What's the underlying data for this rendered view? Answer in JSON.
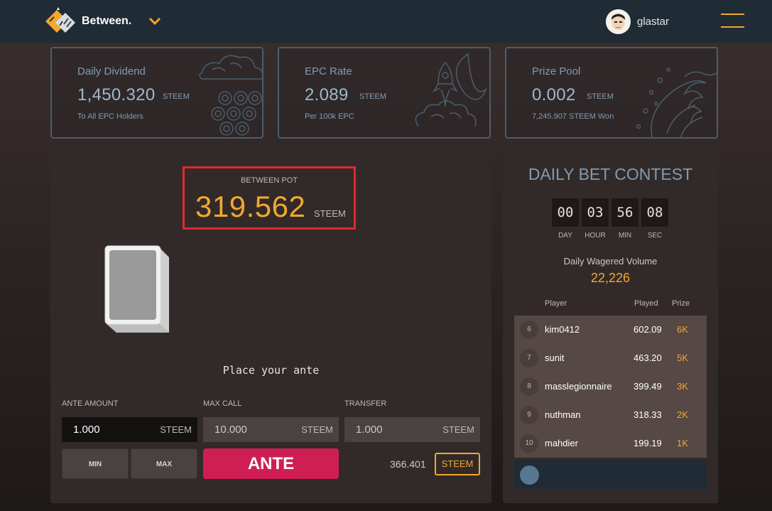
{
  "header": {
    "brand": "Between.",
    "username": "glastar"
  },
  "stats": [
    {
      "title": "Daily Dividend",
      "value": "1,450.320",
      "unit": "STEEM",
      "sub": "To All EPC Holders"
    },
    {
      "title": "EPC Rate",
      "value": "2.089",
      "unit": "STEEM",
      "sub": "Per 100k EPC"
    },
    {
      "title": "Prize Pool",
      "value": "0.002",
      "unit": "STEEM",
      "sub": "7,245.907 STEEM Won"
    }
  ],
  "game": {
    "pot_label": "BETWEEN POT",
    "pot_value": "319.562",
    "pot_unit": "STEEM",
    "prompt": "Place your ante",
    "fields": {
      "ante": {
        "label": "ANTE AMOUNT",
        "value": "1.000",
        "unit": "STEEM"
      },
      "max_call": {
        "label": "MAX CALL",
        "value": "10.000",
        "unit": "STEEM"
      },
      "transfer": {
        "label": "TRANSFER",
        "value": "1.000",
        "unit": "STEEM"
      }
    },
    "min_label": "MIN",
    "max_label": "MAX",
    "ante_label": "ANTE",
    "balance": "366.401",
    "currency_btn": "STEEM"
  },
  "contest": {
    "title": "DAILY BET CONTEST",
    "timer": [
      {
        "value": "00",
        "label": "DAY"
      },
      {
        "value": "03",
        "label": "HOUR"
      },
      {
        "value": "56",
        "label": "MIN"
      },
      {
        "value": "08",
        "label": "SEC"
      }
    ],
    "volume_label": "Daily Wagered Volume",
    "volume_value": "22,226",
    "columns": {
      "player": "Player",
      "played": "Played",
      "prize": "Prize"
    },
    "rows": [
      {
        "rank": "6",
        "player": "kim0412",
        "played": "602.09",
        "prize": "6K"
      },
      {
        "rank": "7",
        "player": "sunit",
        "played": "463.20",
        "prize": "5K"
      },
      {
        "rank": "8",
        "player": "masslegionnaire",
        "played": "399.49",
        "prize": "3K"
      },
      {
        "rank": "9",
        "player": "nuthman",
        "played": "318.33",
        "prize": "2K"
      },
      {
        "rank": "10",
        "player": "mahdier",
        "played": "199.19",
        "prize": "1K"
      }
    ]
  },
  "colors": {
    "accent": "#f0a830",
    "ante_button": "#cf1e53",
    "highlight_border": "#e0282f",
    "header_bg": "#1f2b35",
    "stat_text": "#7f9cb3"
  },
  "icons": [
    "logo-icon",
    "chevron-down-icon",
    "avatar",
    "hamburger-menu-icon",
    "card-icon"
  ]
}
